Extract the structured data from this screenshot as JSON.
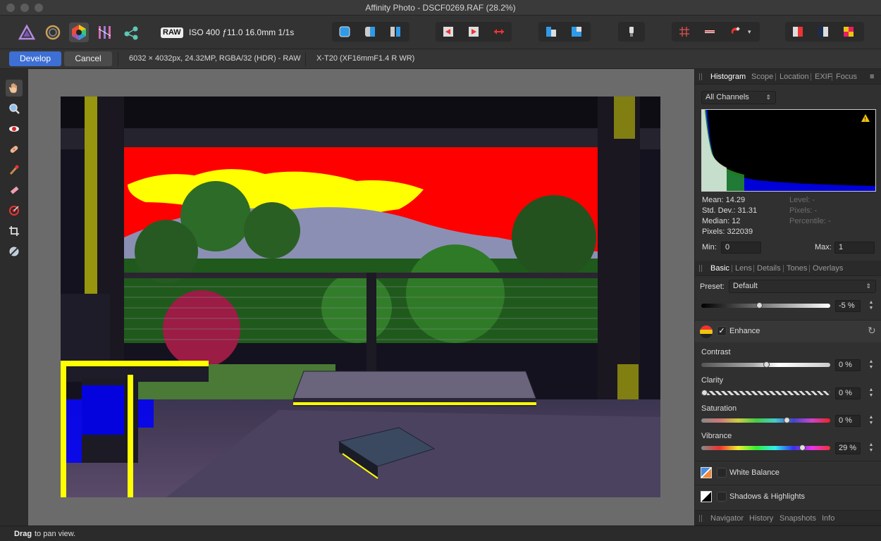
{
  "window": {
    "title": "Affinity Photo - DSCF0269.RAF (28.2%)"
  },
  "toolbar": {
    "personas": [
      "photo-persona",
      "liquify-persona",
      "develop-persona",
      "tone-mapping-persona",
      "export-persona"
    ],
    "raw_badge": "RAW",
    "exif": "ISO 400 ƒ11.0 16.0mm 1/1s"
  },
  "context": {
    "develop_label": "Develop",
    "cancel_label": "Cancel",
    "image_info": "6032 × 4032px, 24.32MP, RGBA/32 (HDR) - RAW",
    "camera_info": "X-T20 (XF16mmF1.4 R WR)"
  },
  "histogram_panel": {
    "tabs": [
      "Histogram",
      "Scope",
      "Location",
      "EXIF",
      "Focus"
    ],
    "channel": "All Channels",
    "mean": "Mean: 14.29",
    "std_dev": "Std. Dev.: 31.31",
    "median": "Median: 12",
    "pixels": "Pixels: 322039",
    "level": "Level: -",
    "pixels_sel": "Pixels: -",
    "percentile": "Percentile: -",
    "min_label": "Min:",
    "min_value": "0",
    "max_label": "Max:",
    "max_value": "1"
  },
  "develop_panel": {
    "tabs": [
      "Basic",
      "Lens",
      "Details",
      "Tones",
      "Overlays"
    ],
    "preset_label": "Preset:",
    "preset_value": "Default",
    "exposure_value": "-5 %",
    "enhance_title": "Enhance",
    "contrast_label": "Contrast",
    "contrast_value": "0 %",
    "clarity_label": "Clarity",
    "clarity_value": "0 %",
    "saturation_label": "Saturation",
    "saturation_value": "0 %",
    "vibrance_label": "Vibrance",
    "vibrance_value": "29 %",
    "white_balance_title": "White Balance",
    "shadows_title": "Shadows & Highlights"
  },
  "bottom_tabs": [
    "Navigator",
    "History",
    "Snapshots",
    "Info"
  ],
  "status": {
    "bold": "Drag",
    "rest": "to pan view."
  },
  "colors": {
    "accent": "#3d6fd4",
    "clip_high": "#ff0000",
    "clip_warn": "#ffff00",
    "clip_low": "#0000ff"
  },
  "slider_levels": {
    "exposure": 0.45,
    "contrast": 0.5,
    "clarity": 0.02,
    "saturation": 0.66,
    "vibrance": 0.78
  }
}
